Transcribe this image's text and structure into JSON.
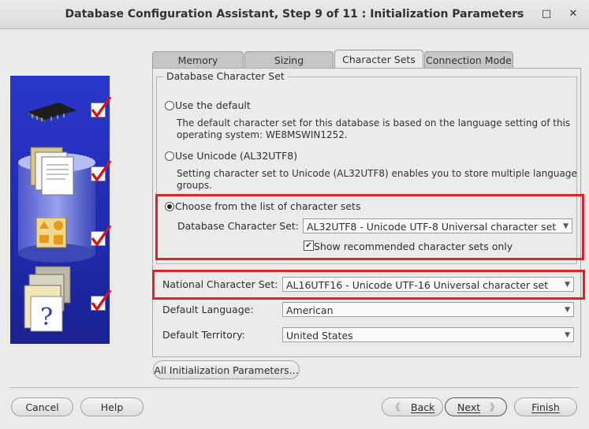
{
  "window": {
    "title": "Database Configuration Assistant, Step 9 of 11 : Initialization Parameters",
    "minimize_glyph": "–",
    "maximize_glyph": "□",
    "close_glyph": "✕"
  },
  "tabs": [
    {
      "label": "Memory"
    },
    {
      "label": "Sizing"
    },
    {
      "label": "Character Sets"
    },
    {
      "label": "Connection Mode"
    }
  ],
  "db_charset": {
    "group_label": "Database Character Set",
    "option_default": "Use the default",
    "default_desc_1": "The default character set for this database is based on the language setting of this",
    "default_desc_2": "operating system: WE8MSWIN1252.",
    "option_unicode": "Use Unicode (AL32UTF8)",
    "unicode_desc_1": "Setting character set to Unicode (AL32UTF8) enables you to store multiple language",
    "unicode_desc_2": "groups.",
    "option_list": "Choose from the list of character sets",
    "field_label": "Database Character Set:",
    "field_value": "AL32UTF8 - Unicode UTF-8 Universal character set",
    "recommended_label": "Show recommended character sets only",
    "recommended_checked": true
  },
  "national": {
    "label": "National Character Set:",
    "value": "AL16UTF16 - Unicode UTF-16 Universal character set"
  },
  "language": {
    "label": "Default Language:",
    "value": "American"
  },
  "territory": {
    "label": "Default Territory:",
    "value": "United States"
  },
  "all_params_button": "All Initialization Parameters...",
  "footer": {
    "cancel": "Cancel",
    "help": "Help",
    "back": "Back",
    "next": "Next",
    "finish": "Finish"
  },
  "colors": {
    "highlight": "#e0202a",
    "art_blue": "#2b37c9",
    "check_red": "#d0151b"
  },
  "icons": [
    "chip-icon",
    "documents-icon",
    "database-icon",
    "shapes-icon",
    "folders-question-icon",
    "checkmark-icon"
  ]
}
